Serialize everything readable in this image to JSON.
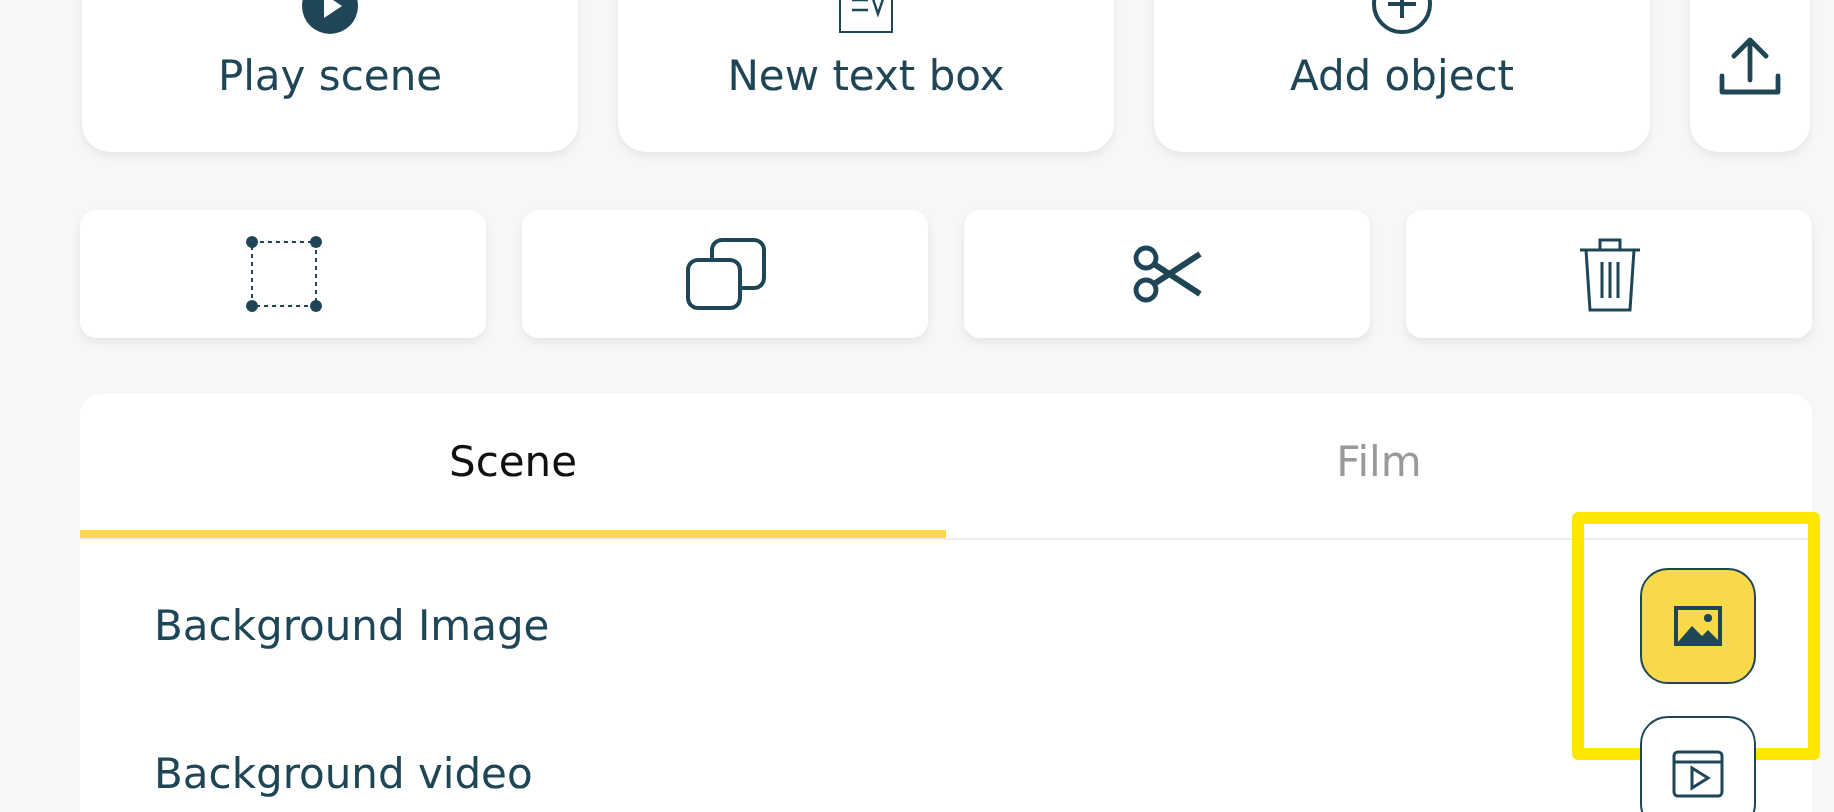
{
  "actions": [
    {
      "kind": "play",
      "label": "Play scene"
    },
    {
      "kind": "text",
      "label": "New text box"
    },
    {
      "kind": "add",
      "label": "Add object"
    },
    {
      "kind": "upload"
    }
  ],
  "tools": [
    {
      "kind": "select"
    },
    {
      "kind": "duplicate"
    },
    {
      "kind": "cut"
    },
    {
      "kind": "delete"
    }
  ],
  "tabs": [
    {
      "label": "Scene",
      "selected": true
    },
    {
      "label": "Film",
      "selected": false
    }
  ],
  "rows": [
    {
      "kind": "image",
      "label": "Background Image",
      "active": true,
      "highlighted": true
    },
    {
      "kind": "video",
      "label": "Background video",
      "active": false,
      "highlighted": false
    }
  ]
}
